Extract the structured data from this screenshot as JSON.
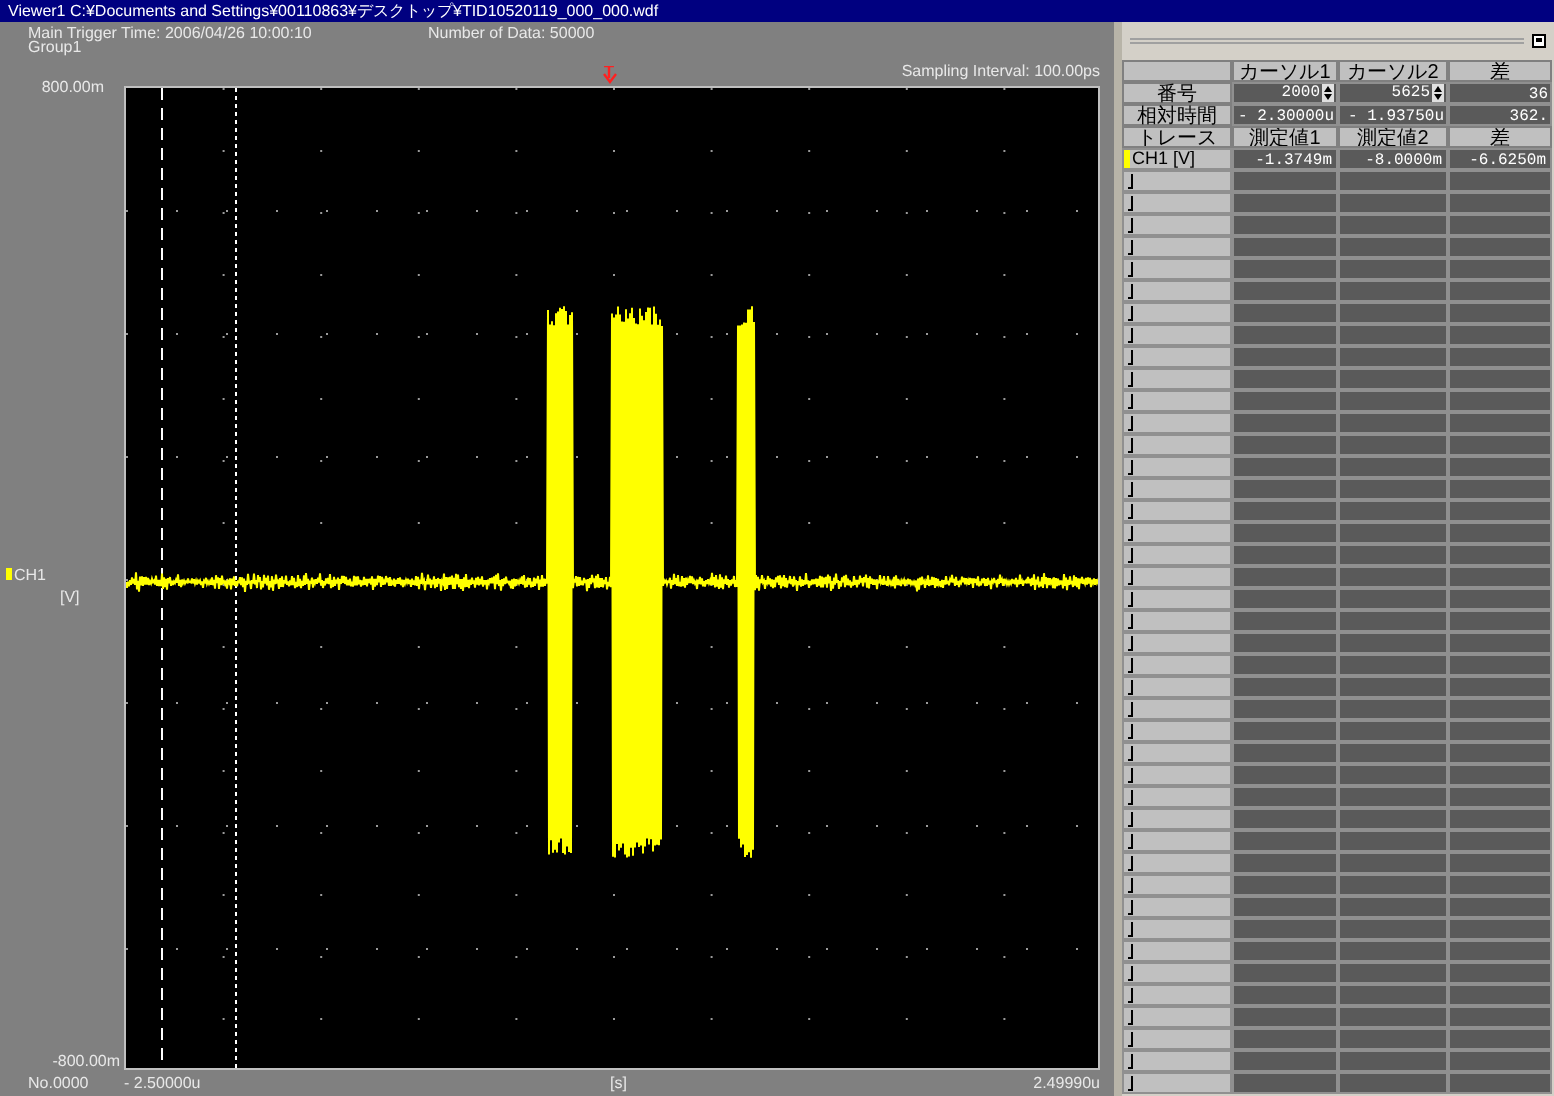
{
  "window": {
    "title": "Viewer1 C:¥Documents and Settings¥00110863¥デスクトップ¥TID10520119_000_000.wdf"
  },
  "header": {
    "trigger_time": "Main Trigger Time: 2006/04/26 10:00:10",
    "group": "Group1",
    "data_count": "Number of Data: 50000",
    "sampling_interval": "Sampling Interval: 100.00ps"
  },
  "y_axis": {
    "max": "800.00m",
    "min": "-800.00m"
  },
  "channel_label": {
    "name": "CH1",
    "unit": "[V]",
    "color": "#ffff00"
  },
  "x_axis": {
    "record_number": "No.0000",
    "start": "- 2.50000u",
    "unit": "[s]",
    "end": "2.49990u"
  },
  "cursor_table": {
    "columns": [
      "カーソル1",
      "カーソル2",
      "差"
    ],
    "rows": [
      {
        "label": "番号",
        "values": [
          "2000",
          "5625",
          "36"
        ],
        "spinner": true
      },
      {
        "label": "相対時間",
        "values": [
          "- 2.30000u",
          "- 1.93750u",
          "362."
        ],
        "spinner": false
      }
    ],
    "trace_header": [
      "トレース",
      "測定値1",
      "測定値2",
      "差"
    ],
    "traces": [
      {
        "name": "CH1 [V]",
        "color": "#ffff00",
        "values": [
          "-1.3749m",
          "-8.0000m",
          "-6.6250m"
        ]
      }
    ]
  }
}
